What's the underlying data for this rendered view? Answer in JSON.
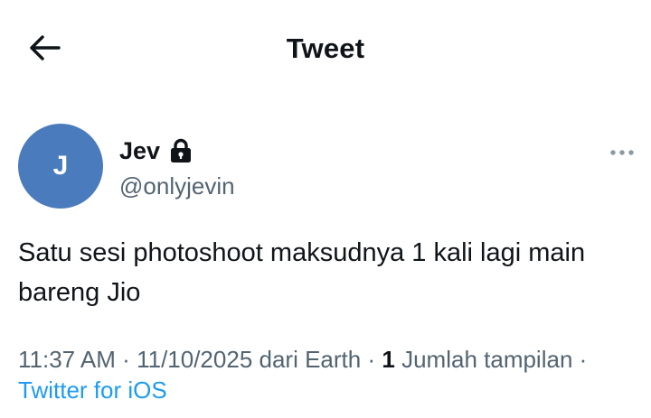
{
  "header": {
    "title": "Tweet",
    "back_icon": "arrow-left-icon"
  },
  "author": {
    "avatar_initial": "J",
    "avatar_color": "#4a7bbd",
    "display_name": "Jev",
    "protected_icon": "lock-icon",
    "handle": "@onlyjevin"
  },
  "more_icon": "more-horizontal-icon",
  "tweet": {
    "text": "Satu sesi photoshoot maksudnya 1 kali lagi main bareng Jio"
  },
  "meta": {
    "time": "11:37 AM",
    "date": "11/10/2025",
    "location": "dari Earth",
    "views_count": "1",
    "views_label": "Jumlah tampilan",
    "client": "Twitter for iOS",
    "separator": "·"
  },
  "colors": {
    "text_primary": "#0f1419",
    "text_secondary": "#536471",
    "link": "#1d9bf0"
  }
}
